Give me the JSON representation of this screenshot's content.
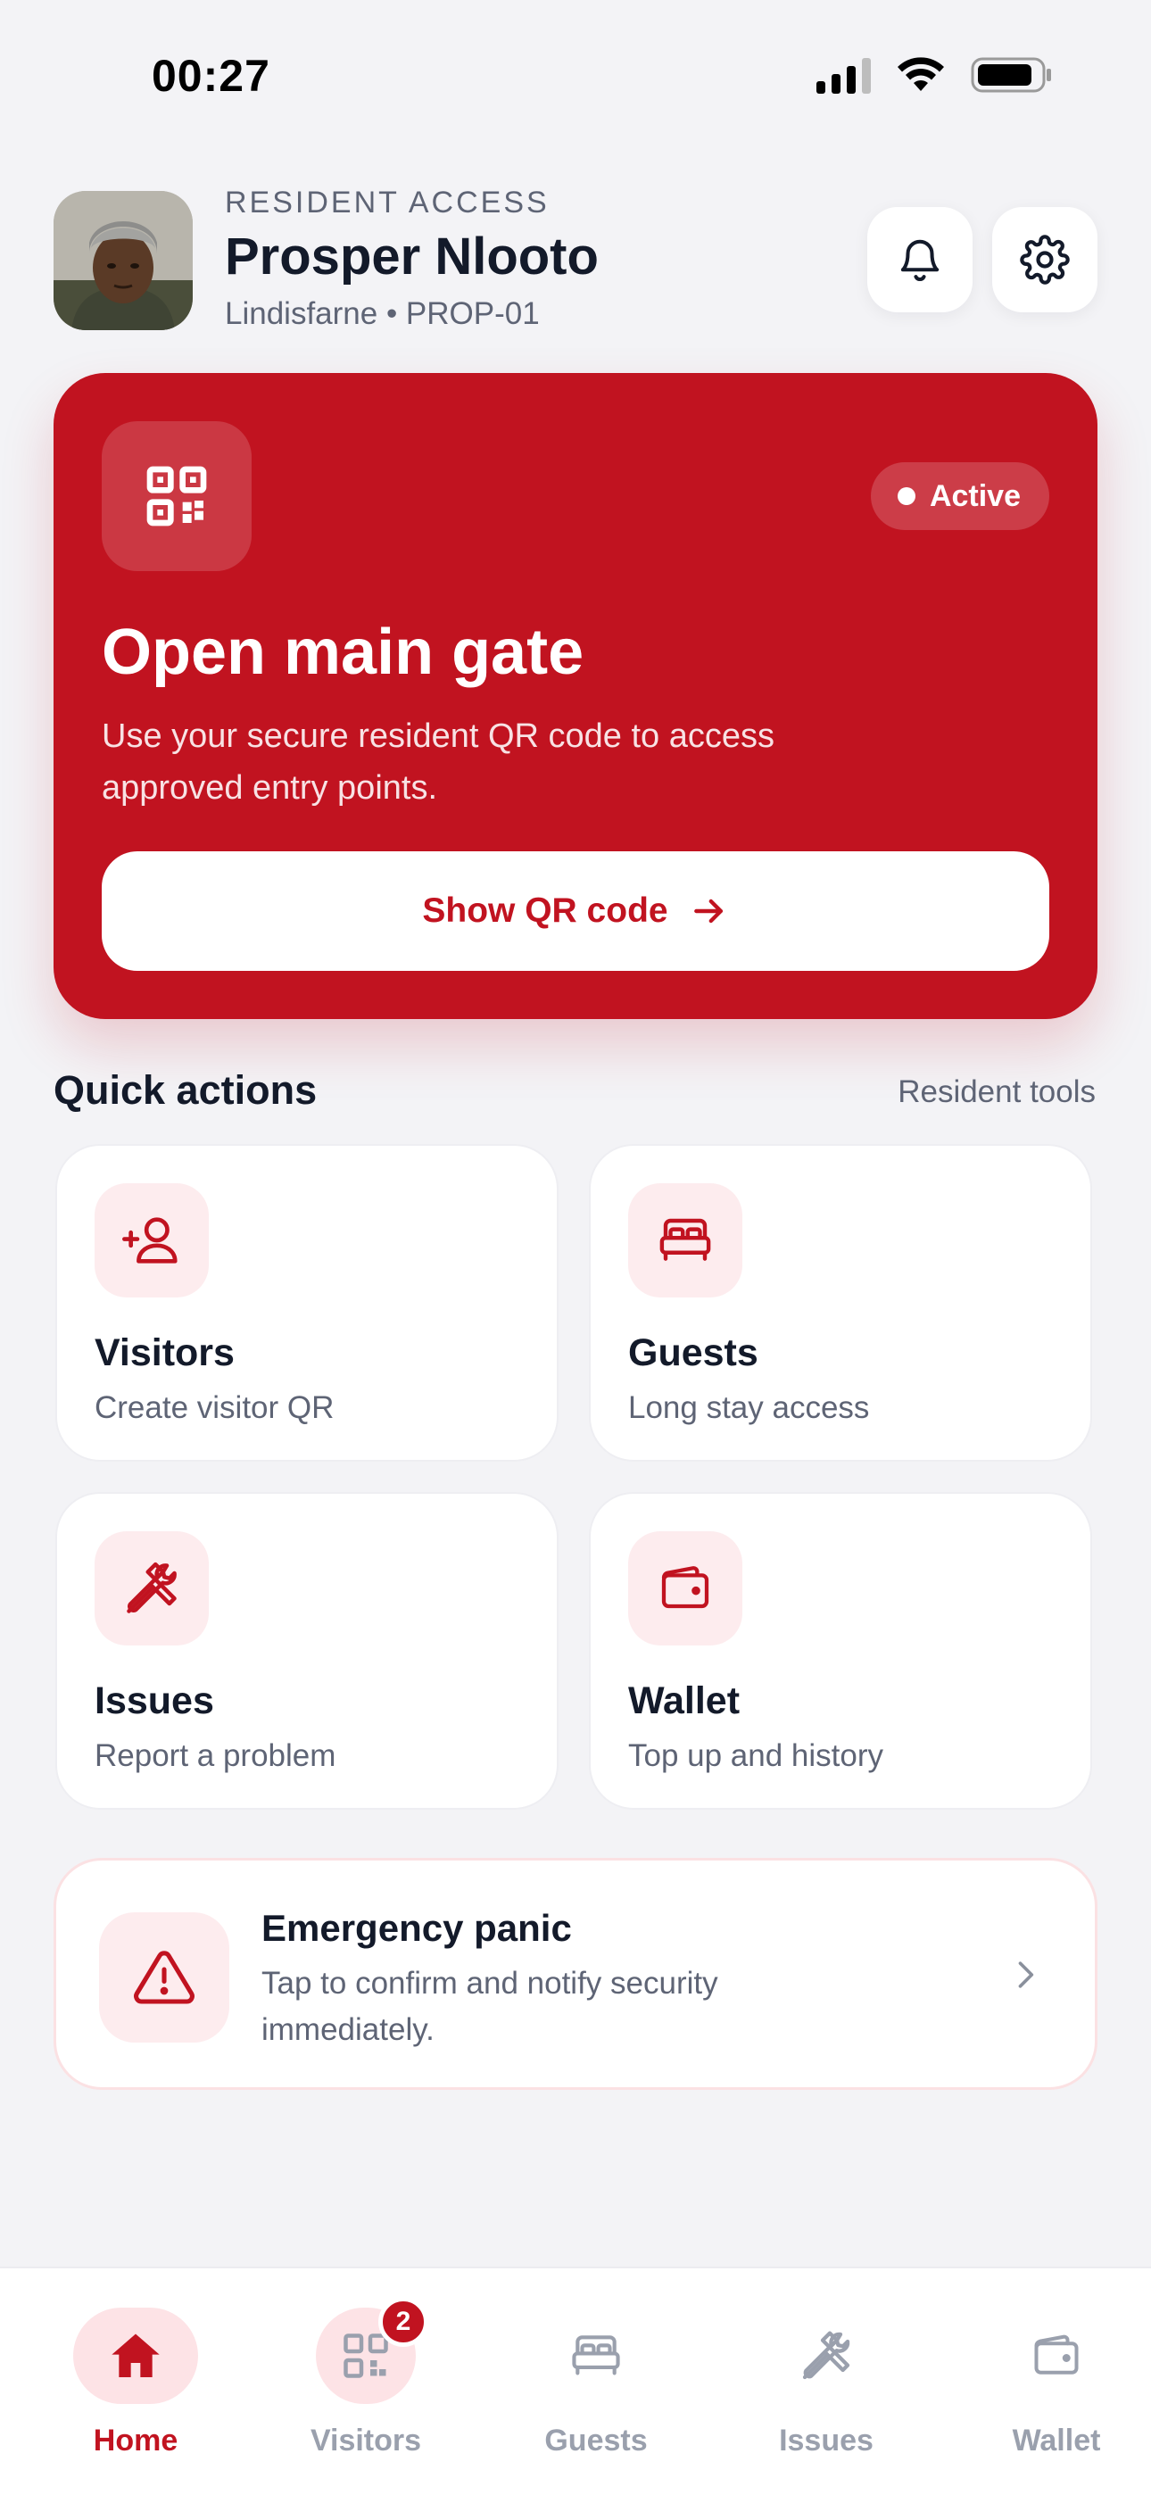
{
  "status_bar": {
    "time": "00:27"
  },
  "header": {
    "eyebrow": "RESIDENT ACCESS",
    "name": "Prosper Nlooto",
    "location": "Lindisfarne • PROP-01"
  },
  "hero": {
    "status": "Active",
    "title": "Open main gate",
    "description": "Use your secure resident QR code to access approved entry points.",
    "button_label": "Show QR code"
  },
  "quick_actions": {
    "title": "Quick actions",
    "link": "Resident tools",
    "items": [
      {
        "title": "Visitors",
        "subtitle": "Create visitor QR",
        "icon": "user-plus-icon"
      },
      {
        "title": "Guests",
        "subtitle": "Long stay access",
        "icon": "bed-icon"
      },
      {
        "title": "Issues",
        "subtitle": "Report a problem",
        "icon": "tools-icon"
      },
      {
        "title": "Wallet",
        "subtitle": "Top up and history",
        "icon": "wallet-icon"
      }
    ]
  },
  "emergency": {
    "title": "Emergency panic",
    "description": "Tap to confirm and notify security immediately."
  },
  "bottom_nav": {
    "items": [
      {
        "label": "Home",
        "icon": "home-icon",
        "active": true
      },
      {
        "label": "Visitors",
        "icon": "qr-code-icon",
        "badge": "2"
      },
      {
        "label": "Guests",
        "icon": "bed-icon"
      },
      {
        "label": "Issues",
        "icon": "tools-icon"
      },
      {
        "label": "Wallet",
        "icon": "wallet-icon"
      }
    ]
  },
  "colors": {
    "accent": "#c11320",
    "accent_soft": "#fdecee",
    "background": "#f3f3f6",
    "text_primary": "#131a2a",
    "text_secondary": "#5e6475",
    "nav_inactive": "#9aa0ad"
  }
}
